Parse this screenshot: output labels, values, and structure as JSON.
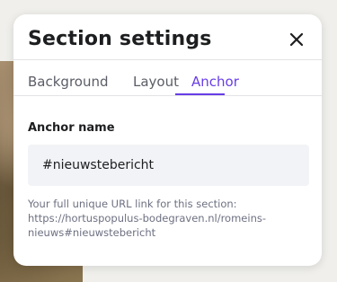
{
  "panel": {
    "title": "Section settings",
    "tabs": [
      {
        "label": "Background",
        "active": false
      },
      {
        "label": "Layout",
        "active": false
      },
      {
        "label": "Anchor",
        "active": true
      }
    ],
    "anchor_field": {
      "label": "Anchor name",
      "value": "#nieuwstebericht"
    },
    "help": {
      "line1": "Your full unique URL link for this section:",
      "line2": "https://hortuspopulus-bodegraven.nl/romeins-",
      "line3": "nieuws#nieuwstebericht"
    }
  },
  "icons": {
    "close": "close-icon"
  },
  "colors": {
    "accent": "#673de6",
    "text": "#1d1e20",
    "muted": "#6d7081",
    "input_bg": "#f2f3f6"
  }
}
